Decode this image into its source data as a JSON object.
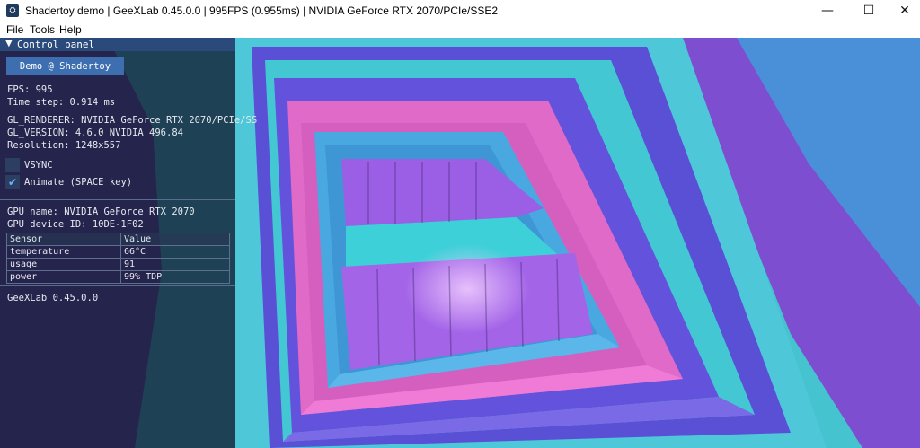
{
  "window": {
    "title": "Shadertoy demo | GeeXLab 0.45.0.0 | 995FPS (0.955ms) | NVIDIA GeForce RTX 2070/PCIe/SSE2",
    "app_icon": "geexlab-logo-icon",
    "minimize_glyph": "—",
    "maximize_glyph": "☐",
    "close_glyph": "✕"
  },
  "menu": {
    "items": [
      "File",
      "Tools",
      "Help"
    ]
  },
  "panel": {
    "header_arrow": "▼",
    "header_label": "Control panel",
    "demo_button": "Demo @ Shadertoy",
    "fps": "FPS: 995",
    "time_step": "Time step: 0.914 ms",
    "gl_renderer": "GL_RENDERER: NVIDIA GeForce RTX 2070/PCIe/SS",
    "gl_version": "GL_VERSION: 4.6.0 NVIDIA 496.84",
    "resolution": "Resolution: 1248x557",
    "vsync_label": "VSYNC",
    "vsync_checked": false,
    "animate_label": "Animate (SPACE key)",
    "animate_checked": true,
    "check_glyph": "✔",
    "gpu_name": "GPU name: NVIDIA GeForce RTX 2070",
    "gpu_device_id": "GPU device ID: 10DE-1F02",
    "sensor_table": {
      "headers": [
        "Sensor",
        "Value"
      ],
      "rows": [
        [
          "temperature",
          "66°C"
        ],
        [
          "usage",
          "91"
        ],
        [
          "power",
          "99% TDP"
        ]
      ]
    },
    "footer": "GeeXLab 0.45.0.0"
  },
  "colors": {
    "panel_header": "#294a7a",
    "button": "#3d6eb0",
    "block_teal": "#45cfd6",
    "block_purple": "#9a58e0",
    "block_pink": "#e062c8",
    "block_blue": "#5a52d8",
    "block_lightblue": "#4aa8e0",
    "floor_violet": "#b07af0"
  }
}
